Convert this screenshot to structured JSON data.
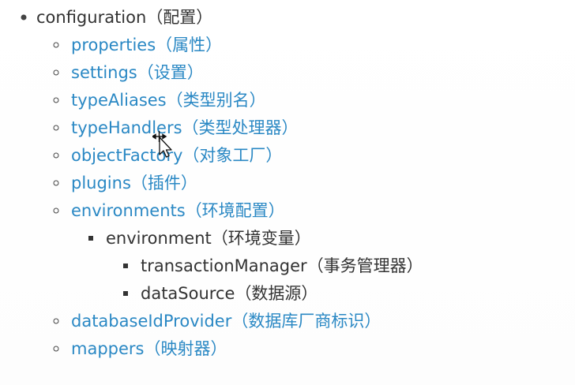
{
  "root": {
    "label": "configuration",
    "note": "（配置）"
  },
  "children": [
    {
      "label": "properties",
      "note": "（属性）"
    },
    {
      "label": "settings",
      "note": "（设置）"
    },
    {
      "label": "typeAliases",
      "note": "（类型别名）"
    },
    {
      "label": "typeHandlers",
      "note": "（类型处理器）"
    },
    {
      "label": "objectFactory",
      "note": "（对象工厂）"
    },
    {
      "label": "plugins",
      "note": "（插件）"
    },
    {
      "label": "environments",
      "note": "（环境配置）"
    },
    {
      "label": "databaseIdProvider",
      "note": "（数据库厂商标识）"
    },
    {
      "label": "mappers",
      "note": "（映射器）"
    }
  ],
  "environment": {
    "label": "environment",
    "note": "（环境变量）",
    "children": [
      {
        "label": "transactionManager",
        "note": "（事务管理器）"
      },
      {
        "label": "dataSource",
        "note": "（数据源）"
      }
    ]
  },
  "colors": {
    "link": "#2a88c4",
    "text": "#333333"
  },
  "icons": {
    "cursor": "move-cursor-icon"
  }
}
